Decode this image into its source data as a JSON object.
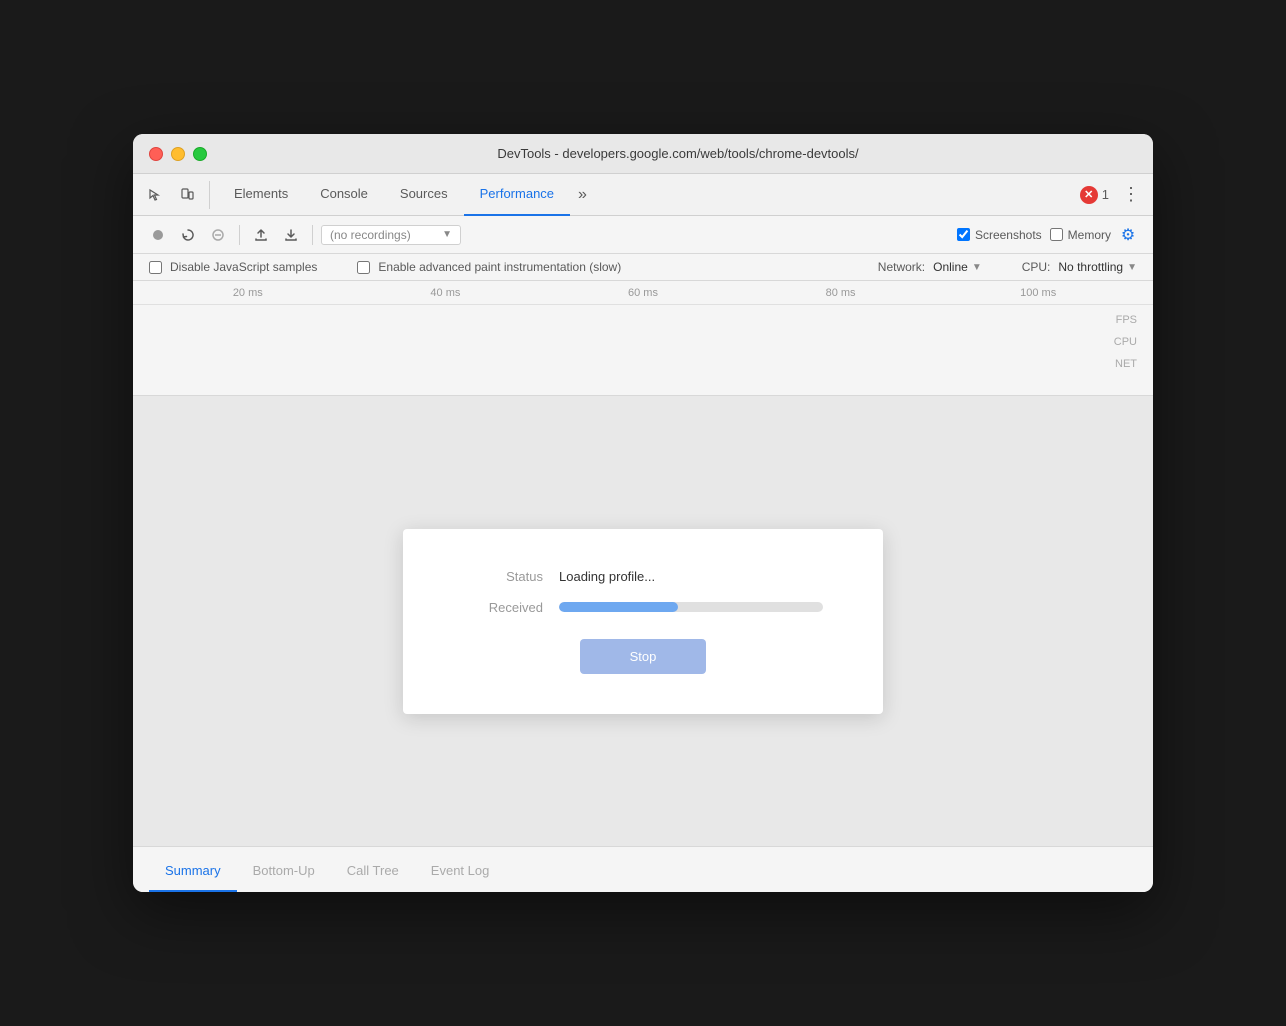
{
  "window": {
    "title": "DevTools - developers.google.com/web/tools/chrome-devtools/"
  },
  "tabs": {
    "items": [
      {
        "label": "Elements",
        "active": false
      },
      {
        "label": "Console",
        "active": false
      },
      {
        "label": "Sources",
        "active": false
      },
      {
        "label": "Performance",
        "active": true
      }
    ],
    "more_label": "»",
    "error_count": "1",
    "menu_icon": "⋮"
  },
  "toolbar": {
    "record_title": "Record",
    "reload_title": "Reload",
    "clear_title": "Clear",
    "upload_title": "Upload profile",
    "download_title": "Download profile",
    "recording_placeholder": "(no recordings)",
    "screenshots_label": "Screenshots",
    "screenshots_checked": true,
    "memory_label": "Memory",
    "memory_checked": false,
    "settings_icon": "⚙"
  },
  "options": {
    "disable_js_label": "Disable JavaScript samples",
    "disable_js_checked": false,
    "advanced_paint_label": "Enable advanced paint instrumentation (slow)",
    "advanced_paint_checked": false,
    "network_label": "Network:",
    "network_value": "Online",
    "cpu_label": "CPU:",
    "cpu_value": "No throttling"
  },
  "timeline": {
    "marks": [
      "20 ms",
      "40 ms",
      "60 ms",
      "80 ms",
      "100 ms"
    ],
    "tracks": [
      {
        "label": "FPS"
      },
      {
        "label": "CPU"
      },
      {
        "label": "NET"
      }
    ]
  },
  "loading_dialog": {
    "status_key": "Status",
    "status_value": "Loading profile...",
    "received_key": "Received",
    "progress_percent": 45,
    "stop_label": "Stop"
  },
  "bottom_tabs": {
    "items": [
      {
        "label": "Summary",
        "active": true
      },
      {
        "label": "Bottom-Up",
        "active": false
      },
      {
        "label": "Call Tree",
        "active": false
      },
      {
        "label": "Event Log",
        "active": false
      }
    ]
  },
  "colors": {
    "active_tab": "#1a73e8",
    "progress_fill": "#6ea8f0",
    "stop_button": "#a0b8e8"
  }
}
